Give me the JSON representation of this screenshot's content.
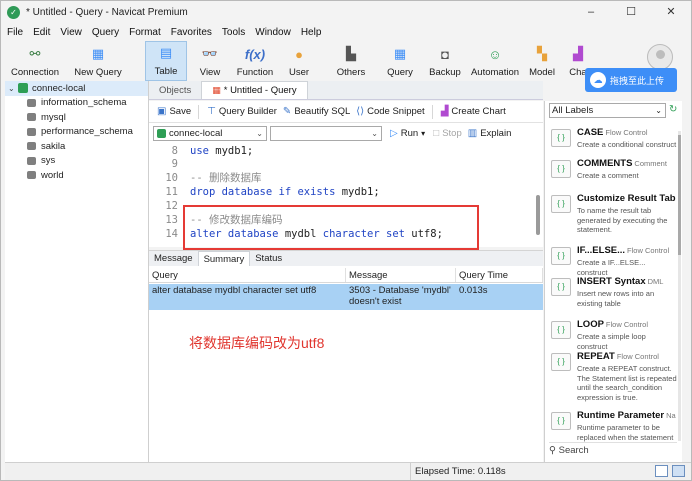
{
  "window": {
    "title": "* Untitled - Query - Navicat Premium",
    "controls": [
      "–",
      "☐",
      "✕"
    ]
  },
  "menu": [
    "File",
    "Edit",
    "View",
    "Query",
    "Format",
    "Favorites",
    "Tools",
    "Window",
    "Help"
  ],
  "toolbar": [
    {
      "id": "connection",
      "label": "Connection",
      "icon": "connection-icon",
      "color": "#3a7d44"
    },
    {
      "id": "new-query",
      "label": "New Query",
      "icon": "new-query-icon",
      "color": "#3d8ef7"
    },
    {
      "id": "table",
      "label": "Table",
      "icon": "table-icon",
      "color": "#3d8ef7"
    },
    {
      "id": "view",
      "label": "View",
      "icon": "view-icon",
      "color": "#3d8ef7"
    },
    {
      "id": "function",
      "label": "Function",
      "icon": "function-icon",
      "color": "#3d6fc9"
    },
    {
      "id": "user",
      "label": "User",
      "icon": "user-icon",
      "color": "#e8a23b"
    },
    {
      "id": "others",
      "label": "Others",
      "icon": "others-icon",
      "color": "#555555"
    },
    {
      "id": "query",
      "label": "Query",
      "icon": "query-icon",
      "color": "#3d8ef7"
    },
    {
      "id": "backup",
      "label": "Backup",
      "icon": "backup-icon",
      "color": "#555555"
    },
    {
      "id": "automation",
      "label": "Automation",
      "icon": "automation-icon",
      "color": "#2e9e55"
    },
    {
      "id": "model",
      "label": "Model",
      "icon": "model-icon",
      "color": "#e8a23b"
    },
    {
      "id": "chart",
      "label": "Cha",
      "icon": "chart-icon",
      "color": "#b04ad0"
    }
  ],
  "upload_badge": "拖拽至此上传",
  "navigator": {
    "connection": "connec-local",
    "databases": [
      "information_schema",
      "mysql",
      "performance_schema",
      "sakila",
      "sys",
      "world"
    ]
  },
  "tabs": {
    "objects": "Objects",
    "query": "* Untitled - Query"
  },
  "query_toolbar": {
    "save": "Save",
    "builder": "Query Builder",
    "beautify": "Beautify SQL",
    "snippet": "Code Snippet",
    "create_chart": "Create Chart"
  },
  "connection_bar": {
    "connection": "connec-local",
    "database": "",
    "run": "Run",
    "stop": "Stop",
    "explain": "Explain"
  },
  "editor": {
    "lines": [
      {
        "n": "8",
        "tokens": [
          {
            "t": "kw",
            "v": "use"
          },
          {
            "t": "tx",
            "v": " mydb1;"
          }
        ]
      },
      {
        "n": "9",
        "tokens": []
      },
      {
        "n": "10",
        "tokens": [
          {
            "t": "cm",
            "v": "-- 删除数据库"
          }
        ]
      },
      {
        "n": "11",
        "tokens": [
          {
            "t": "kw",
            "v": "drop database if exists"
          },
          {
            "t": "tx",
            "v": " mydb1;"
          }
        ]
      },
      {
        "n": "12",
        "tokens": []
      },
      {
        "n": "13",
        "tokens": [
          {
            "t": "cm",
            "v": "-- 修改数据库编码"
          }
        ]
      },
      {
        "n": "14",
        "tokens": [
          {
            "t": "kw",
            "v": "alter database"
          },
          {
            "t": "tx",
            "v": " mydbl "
          },
          {
            "t": "kw",
            "v": "character set"
          },
          {
            "t": "tx",
            "v": " utf8;"
          }
        ]
      }
    ]
  },
  "result_tabs": [
    "Message",
    "Summary",
    "Status"
  ],
  "results": {
    "columns": [
      "Query",
      "Message",
      "Query Time"
    ],
    "rows": [
      {
        "query": "alter database mydbl character set utf8",
        "message": "3503 - Database 'mydbl' doesn't exist",
        "time": "0.013s"
      }
    ]
  },
  "annotation": "将数据库编码改为utf8",
  "snippets_panel": {
    "filter": "All Labels",
    "items": [
      {
        "title": "CASE",
        "tag": "Flow Control",
        "desc": "Create a conditional construct"
      },
      {
        "title": "COMMENTS",
        "tag": "Comment",
        "desc": "Create a comment"
      },
      {
        "title": "Customize Result Tab N",
        "tag": "",
        "desc": "To name the result tab generated by executing the statement."
      },
      {
        "title": "IF...ELSE...",
        "tag": "Flow Control",
        "desc": "Create a IF...ELSE... construct"
      },
      {
        "title": "INSERT Syntax",
        "tag": "DML",
        "desc": "Insert new rows into an existing table"
      },
      {
        "title": "LOOP",
        "tag": "Flow Control",
        "desc": "Create a simple loop construct"
      },
      {
        "title": "REPEAT",
        "tag": "Flow Control",
        "desc": "Create a REPEAT construct. The Statement list is repeated until the search_condition expression is true."
      },
      {
        "title": "Runtime Parameter",
        "tag": "Na",
        "desc": "Runtime parameter to be replaced when the statement is"
      }
    ],
    "search": "Search"
  },
  "status": {
    "elapsed": "Elapsed Time: 0.118s"
  }
}
